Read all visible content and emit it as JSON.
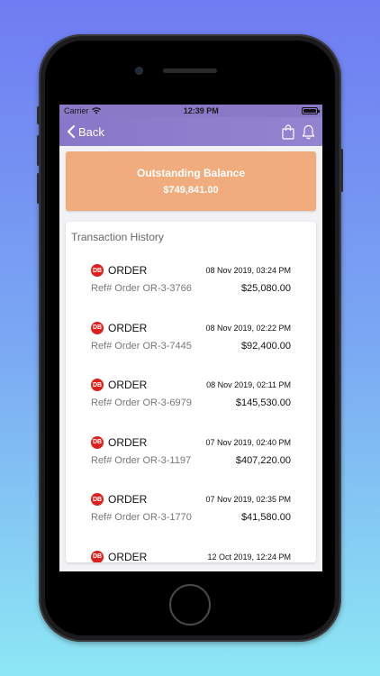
{
  "status_bar": {
    "carrier": "Carrier",
    "time": "12:39 PM"
  },
  "nav": {
    "back_label": "Back"
  },
  "balance": {
    "title": "Outstanding Balance",
    "amount": "$749,841.00"
  },
  "history": {
    "title": "Transaction History",
    "badge": "DB",
    "transactions": [
      {
        "type": "ORDER",
        "date": "08 Nov 2019, 03:24 PM",
        "ref": "Ref# Order OR-3-3766",
        "amount": "$25,080.00"
      },
      {
        "type": "ORDER",
        "date": "08 Nov 2019, 02:22 PM",
        "ref": "Ref# Order OR-3-7445",
        "amount": "$92,400.00"
      },
      {
        "type": "ORDER",
        "date": "08 Nov 2019, 02:11 PM",
        "ref": "Ref# Order OR-3-6979",
        "amount": "$145,530.00"
      },
      {
        "type": "ORDER",
        "date": "07 Nov 2019, 02:40 PM",
        "ref": "Ref# Order OR-3-1197",
        "amount": "$407,220.00"
      },
      {
        "type": "ORDER",
        "date": "07 Nov 2019, 02:35 PM",
        "ref": "Ref# Order OR-3-1770",
        "amount": "$41,580.00"
      },
      {
        "type": "ORDER",
        "date": "12 Oct 2019, 12:24 PM",
        "ref": "",
        "amount": ""
      }
    ]
  },
  "colors": {
    "nav_bar": "#8877c8",
    "balance_card": "#f0ac7c",
    "badge": "#e0211b"
  }
}
